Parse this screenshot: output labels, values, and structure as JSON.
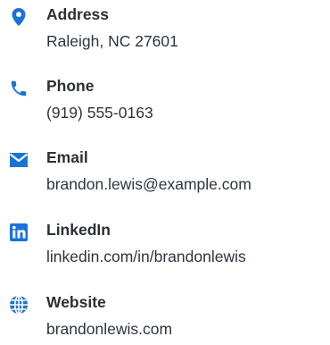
{
  "accent_color": "#1a73d9",
  "contacts": [
    {
      "icon": "map-pin-icon",
      "label": "Address",
      "value": "Raleigh, NC 27601"
    },
    {
      "icon": "phone-icon",
      "label": "Phone",
      "value": "(919) 555-0163"
    },
    {
      "icon": "envelope-icon",
      "label": "Email",
      "value": "brandon.lewis@example.com"
    },
    {
      "icon": "linkedin-icon",
      "label": "LinkedIn",
      "value": "linkedin.com/in/brandonlewis"
    },
    {
      "icon": "globe-icon",
      "label": "Website",
      "value": "brandonlewis.com"
    }
  ]
}
